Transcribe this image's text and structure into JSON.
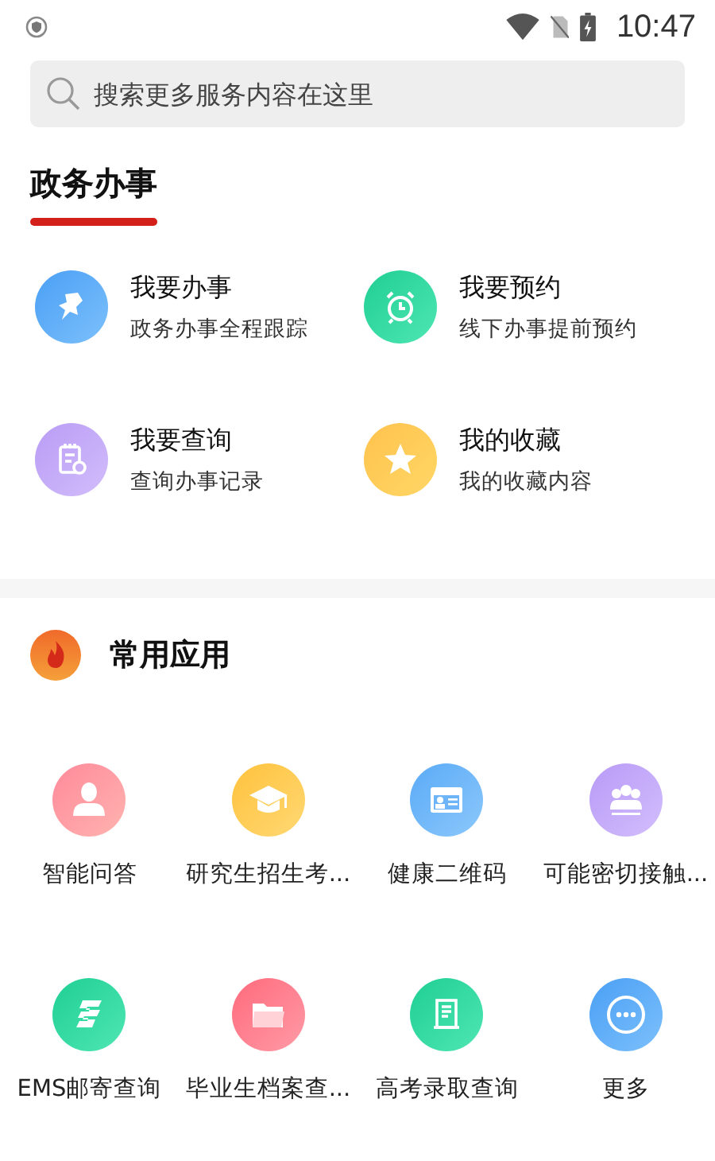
{
  "status_bar": {
    "time": "10:47"
  },
  "search": {
    "placeholder": "搜索更多服务内容在这里"
  },
  "section_title": "政务办事",
  "services": [
    {
      "kind": "pin",
      "title": "我要办事",
      "subtitle": "政务办事全程跟踪"
    },
    {
      "kind": "alarm",
      "title": "我要预约",
      "subtitle": "线下办事提前预约"
    },
    {
      "kind": "notes",
      "title": "我要查询",
      "subtitle": "查询办事记录"
    },
    {
      "kind": "star",
      "title": "我的收藏",
      "subtitle": "我的收藏内容"
    }
  ],
  "apps_header": {
    "title": "常用应用"
  },
  "apps": [
    {
      "kind": "person",
      "label": "智能问答"
    },
    {
      "kind": "cap",
      "label": "研究生招生考..."
    },
    {
      "kind": "card",
      "label": "健康二维码"
    },
    {
      "kind": "group",
      "label": "可能密切接触..."
    },
    {
      "kind": "post",
      "label": "EMS邮寄查询"
    },
    {
      "kind": "folder",
      "label": "毕业生档案查..."
    },
    {
      "kind": "scroll",
      "label": "高考录取查询"
    },
    {
      "kind": "more",
      "label": "更多"
    }
  ]
}
